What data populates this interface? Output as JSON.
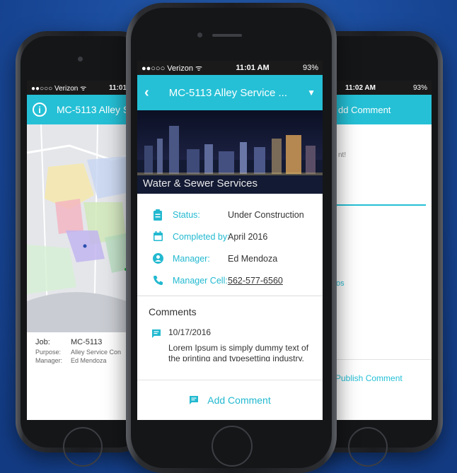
{
  "left": {
    "status": {
      "carrier": "●●○○○ Verizon ᯤ",
      "time": "11:01 AM"
    },
    "title": "MC-5113 Alley S",
    "job_label": "Job:",
    "job_value": "MC-5113",
    "purpose_label": "Purpose:",
    "purpose_value": "Alley Service Con",
    "manager_label": "Manager:",
    "manager_value": "Ed Mendoza"
  },
  "center": {
    "status": {
      "carrier": "●●○○○ Verizon ᯤ",
      "time": "11:01 AM",
      "battery": "93%"
    },
    "title": "MC-5113 Alley Service ...",
    "banner_caption": "Water & Sewer Services",
    "details": [
      {
        "icon": "clipboard-icon",
        "label": "Status:",
        "value": "Under Construction"
      },
      {
        "icon": "calendar-icon",
        "label": "Completed by:",
        "value": "April 2016"
      },
      {
        "icon": "person-icon",
        "label": "Manager:",
        "value": "Ed Mendoza"
      },
      {
        "icon": "phone-icon",
        "label": "Manager Cell:",
        "value": "562-577-6560"
      }
    ],
    "comments_heading": "Comments",
    "comment_date": "10/17/2016",
    "comment_text": "Lorem Ipsum is simply dummy text of the printing and typesetting industry.",
    "add_comment": "Add Comment"
  },
  "right": {
    "status": {
      "time": "11:02 AM",
      "battery": "93%"
    },
    "title": "dd Comment",
    "prompt_fragment": "nt!",
    "photos_fragment": "tos",
    "publish": "Publish Comment"
  },
  "colors": {
    "accent": "#25c0d6",
    "background": "#1b4c9e"
  }
}
